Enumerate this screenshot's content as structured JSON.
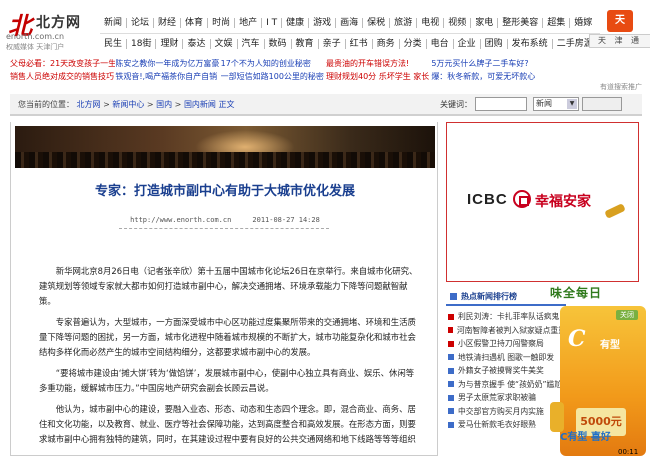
{
  "header": {
    "logo_mark": "北",
    "logo_cn": "北方网",
    "logo_url": "enorth.com.cn",
    "logo_tag": "权威媒体  天津门户",
    "nav_row1": [
      "新闻",
      "论坛",
      "财经",
      "体育",
      "时尚",
      "地产",
      "I T",
      "健康",
      "游戏",
      "画海",
      "保税",
      "旅游",
      "电视",
      "视频",
      "家电",
      "整形美容",
      "超集",
      "婚嫁"
    ],
    "nav_row2": [
      "民生",
      "18街",
      "理财",
      "泰达",
      "文娱",
      "汽车",
      "数码",
      "教育",
      "亲子",
      "红书",
      "商务",
      "分类",
      "电台",
      "企业",
      "团购",
      "发布系统",
      "二手房源"
    ],
    "badge": "天",
    "tiandi": "天 津 通"
  },
  "ad_links": {
    "row1": [
      "父母必看：21天改变孩子一生",
      "陈安之教你一年成为亿万富豪",
      "17个不为人知的创业秘密",
      "最贵油的开车错误方法!",
      "5万元买什么牌子二手车好?",
      ""
    ],
    "row2": [
      "销售人员绝对成交的销售技巧",
      "铁观音!,喝产福茶你自产自销",
      "一部短信如路100公里的秘密",
      "理财规划40分 乐坏学生 家长",
      "爆：秋冬新款，可爱无坏款心",
      ""
    ],
    "right_note": "有道搜索推广"
  },
  "breadcrumb": {
    "label": "您当前的位置：",
    "items": [
      "北方网",
      "新闻中心",
      "国内",
      "国内新闻 正文"
    ],
    "search_label": "关键词：",
    "search_value": "",
    "select_value": "新闻",
    "go_label": ""
  },
  "article": {
    "title": "专家：打造城市副中心有助于大城市优化发展",
    "url": "http://www.enorth.com.cn",
    "date": "2011-08-27 14:28",
    "paragraphs": [
      "新华网北京8月26日电（记者张辛欣）第十五届中国城市化论坛26日在京举行。来自城市化研究、建筑规划等领域专家就大都市如何打造城市副中心，解决交通拥堵、环境承载能力下降等问题献智献策。",
      "专家普遍认为，大型城市，一方面深受城市中心区功能过度集聚所带来的交通拥堵、环境和生活质量下降等问题的困扰，另一方面，城市化进程中随着城市规模的不断扩大，城市功能复杂化和城市社会结构多样化而必然产生的城市空间结构细分，这都要求城市副中心的发展。",
      "“要将城市建设由‘摊大饼’转为‘做馅饼’，发展城市副中心，使副中心独立具有商业、娱乐、休闲等多重功能，缓解城市压力。”中国房地产研究会副会长顾云昌说。",
      "他认为，城市副中心的建设，要融入业态、形态、动态和生态四个理念。即，混合商业、商务、居住和文化功能，以及教育、就业、医疗等社会保障功能，达到高度整合和高效发展。在形态方面，则要求城市副中心拥有独特的建筑，同时，在其建设过程中要有良好的公共交通网络和地下线路等等等组织"
    ]
  },
  "right_ad": {
    "brand": "ICBC",
    "slogan": "幸福安家"
  },
  "hot": {
    "title": "热点新闻排行榜",
    "items": [
      "利民刘涛：卡扎菲率队话疯鬼",
      "河南智障者被判入狱家疑点重重",
      "小区假警卫持刀闯警察局",
      "地铁清扫遇机 图歌一触即发",
      "外籍女子被摸臀奖牛美奖",
      "为与普京握手 使“孩奶奶”尴尬",
      "男子太原荒冢求职被骗",
      "中交部官方购买月内实施",
      "爱马仕新款毛衣好眼熟"
    ]
  },
  "fly_ad": {
    "top": "味全每日",
    "letter": "C",
    "brand": "有型",
    "amount": "5000元",
    "close": "关闭",
    "bottom": "C有型 喜好"
  },
  "clock": "00:11",
  "colors": {
    "title": "#1a3f8f",
    "brand_red": "#c8001e",
    "link_blue": "#1a3fb5",
    "hot_rule": "#3d6cc8"
  }
}
